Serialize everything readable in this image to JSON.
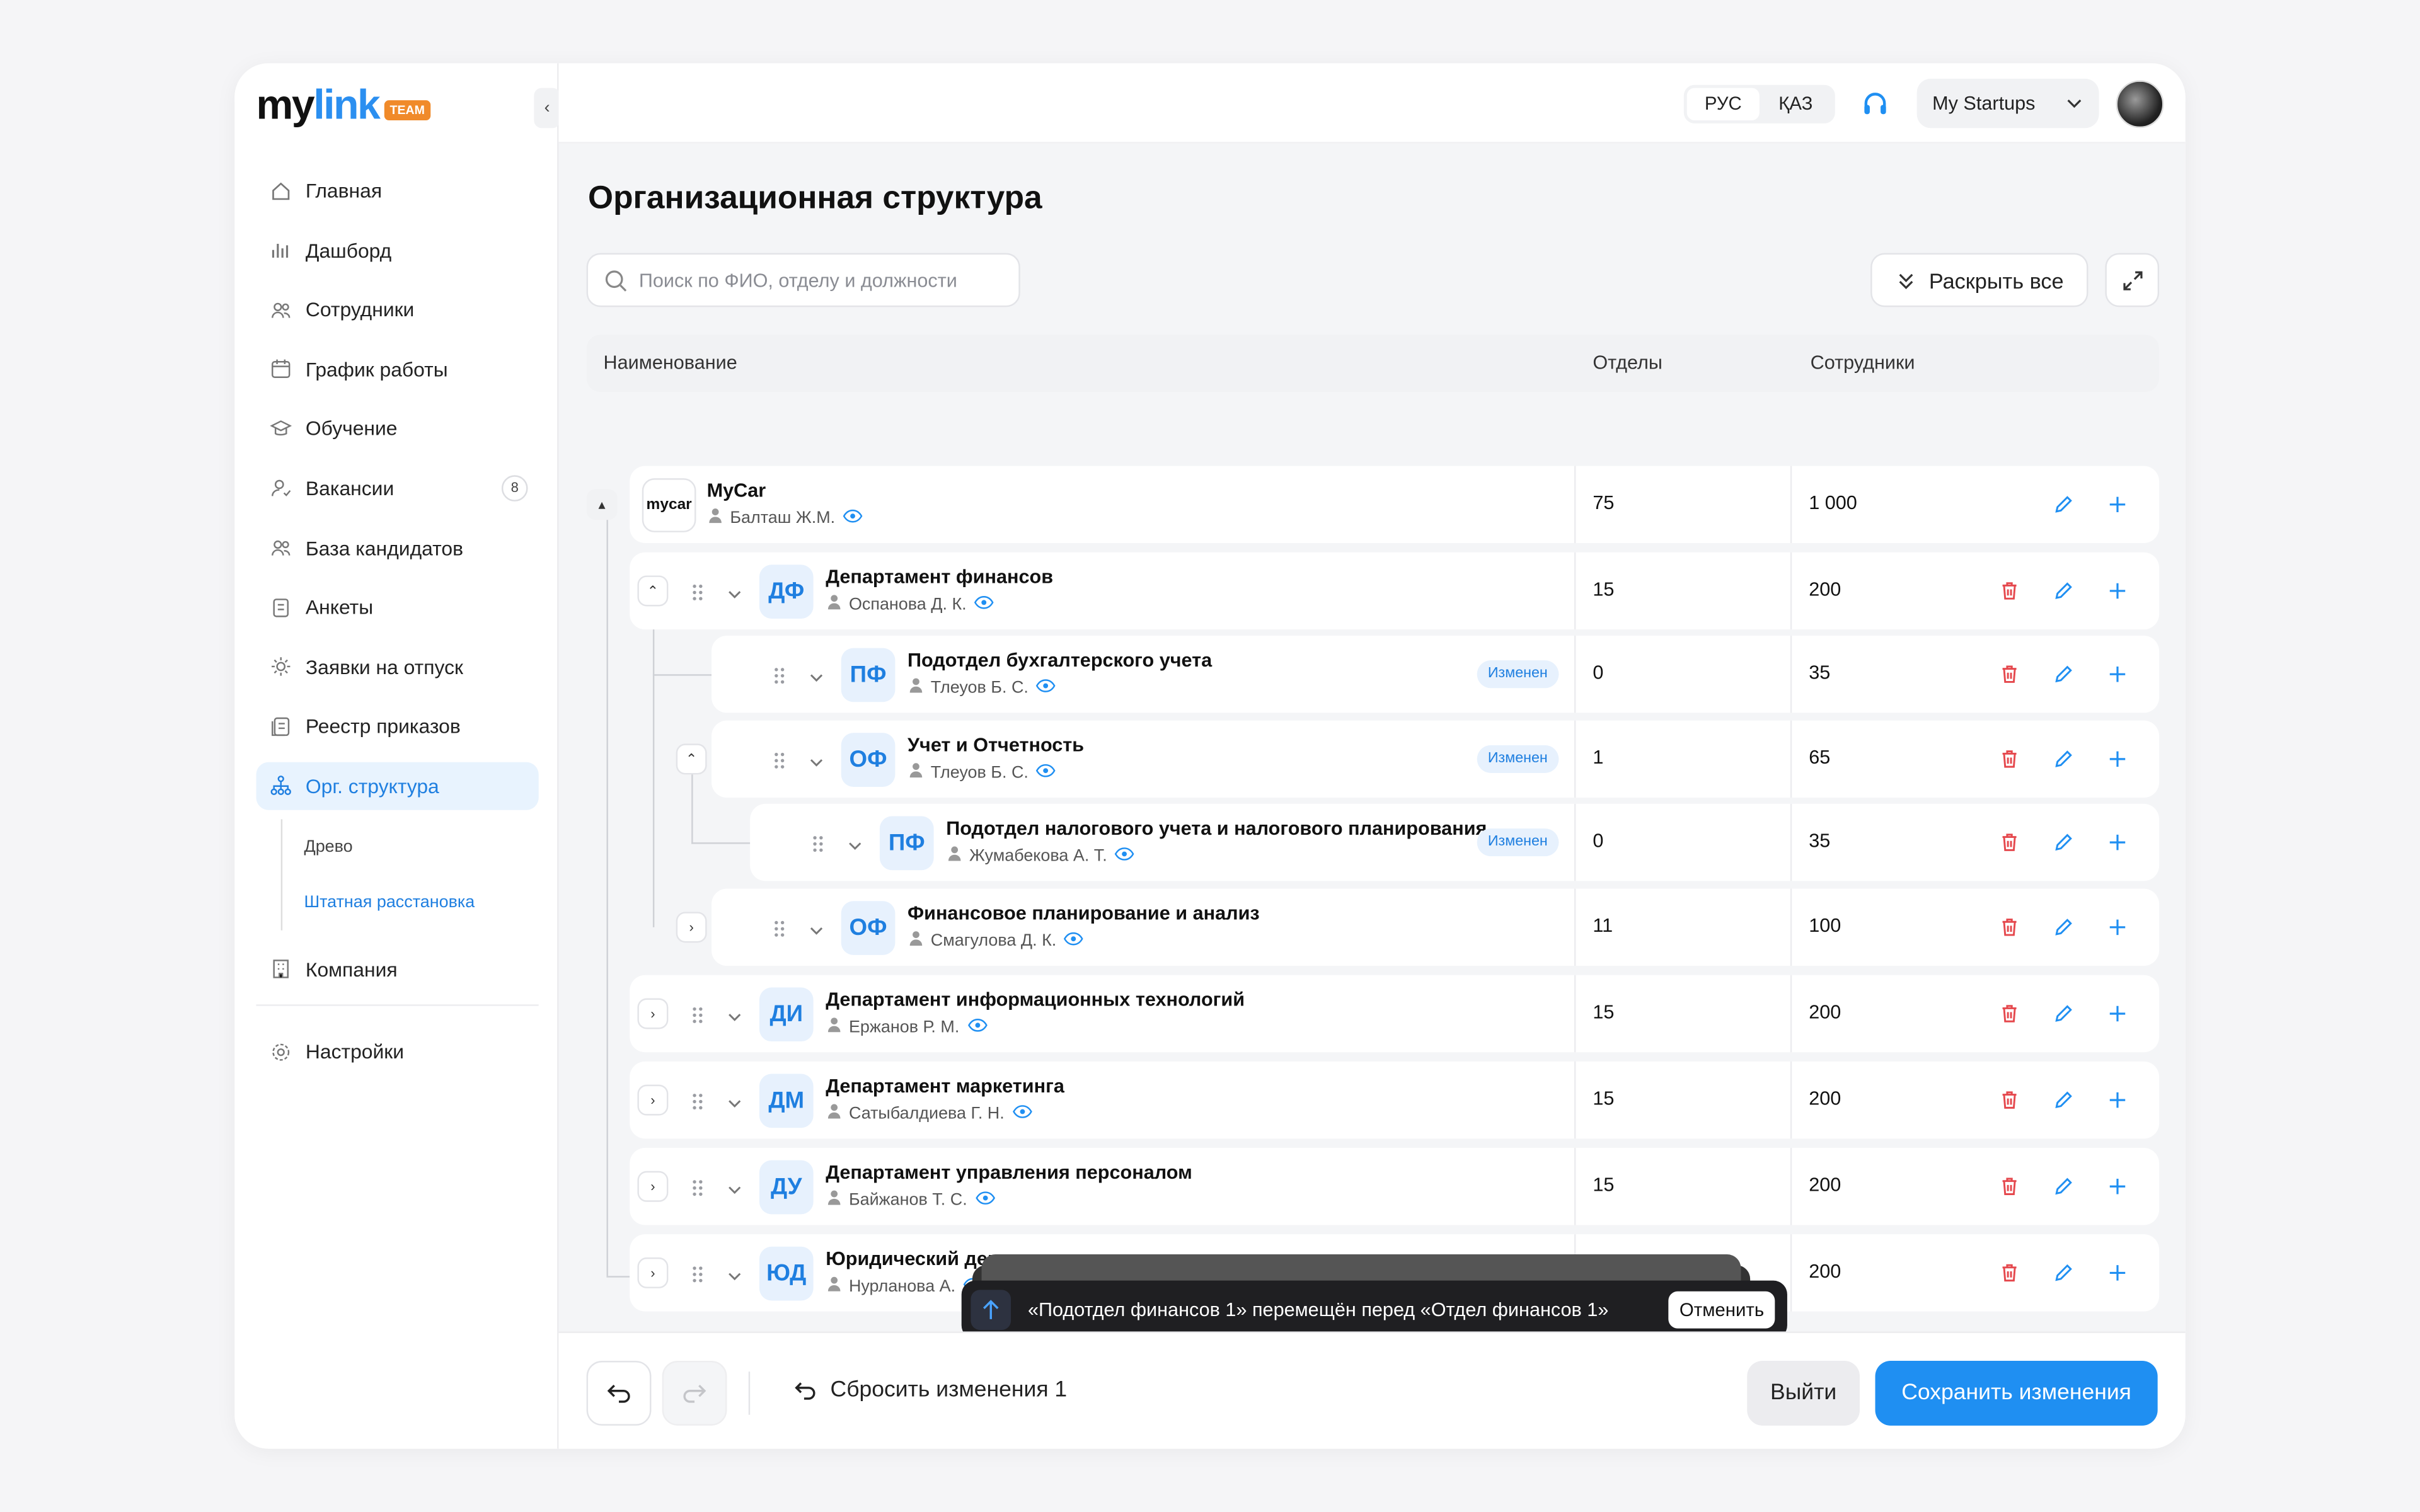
{
  "app": {
    "logo_my": "mylink",
    "logo_team": "TEAM"
  },
  "sidebar": {
    "items": [
      {
        "label": "Главная",
        "icon": "home-icon"
      },
      {
        "label": "Дашборд",
        "icon": "chart-icon"
      },
      {
        "label": "Сотрудники",
        "icon": "users-icon"
      },
      {
        "label": "График работы",
        "icon": "calendar-icon"
      },
      {
        "label": "Обучение",
        "icon": "education-icon"
      },
      {
        "label": "Вакансии",
        "icon": "vacancy-icon",
        "badge": "8"
      },
      {
        "label": "База кандидатов",
        "icon": "candidates-icon"
      },
      {
        "label": "Анкеты",
        "icon": "form-icon"
      },
      {
        "label": "Заявки на отпуск",
        "icon": "sun-icon"
      },
      {
        "label": "Реестр приказов",
        "icon": "orders-icon"
      },
      {
        "label": "Орг. структура",
        "icon": "org-icon",
        "active": true
      }
    ],
    "sub": [
      "Древо",
      "Штатная расстановка"
    ],
    "company": "Компания",
    "settings": "Настройки"
  },
  "topbar": {
    "lang": [
      "РУС",
      "ҚАЗ"
    ],
    "lang_active": "РУС",
    "workspace": "My Startups"
  },
  "page": {
    "title": "Организационная структура",
    "search_placeholder": "Поиск по ФИО, отделу и должности",
    "expand_all": "Раскрыть все"
  },
  "table": {
    "headers": {
      "name": "Наименование",
      "depts": "Отделы",
      "employees": "Сотрудники"
    },
    "root": {
      "name": "MyCar",
      "logo": "mycar",
      "person": "Балташ Ж.М.",
      "depts": "75",
      "employees": "1 000"
    },
    "rows": [
      {
        "abbr": "ДФ",
        "name": "Департамент финансов",
        "person": "Оспанова Д. К.",
        "depts": "15",
        "employees": "200",
        "tag": ""
      },
      {
        "abbr": "ПФ",
        "name": "Подотдел бухгалтерского учета",
        "person": "Тлеуов Б. С.",
        "depts": "0",
        "employees": "35",
        "tag": "Изменен"
      },
      {
        "abbr": "ОФ",
        "name": "Учет и Отчетность",
        "person": "Тлеуов Б. С.",
        "depts": "1",
        "employees": "65",
        "tag": "Изменен"
      },
      {
        "abbr": "ПФ",
        "name": "Подотдел налогового учета и налогового планирования",
        "person": "Жумабекова А. Т.",
        "depts": "0",
        "employees": "35",
        "tag": "Изменен"
      },
      {
        "abbr": "ОФ",
        "name": "Финансовое планирование и анализ",
        "person": "Смагулова Д. К.",
        "depts": "11",
        "employees": "100",
        "tag": ""
      },
      {
        "abbr": "ДИ",
        "name": "Департамент информационных технологий",
        "person": "Ержанов Р. М.",
        "depts": "15",
        "employees": "200",
        "tag": ""
      },
      {
        "abbr": "ДМ",
        "name": "Департамент маркетинга",
        "person": "Сатыбалдиева Г. Н.",
        "depts": "15",
        "employees": "200",
        "tag": ""
      },
      {
        "abbr": "ДУ",
        "name": "Департамент управления персоналом",
        "person": "Байжанов Т. С.",
        "depts": "15",
        "employees": "200",
        "tag": ""
      },
      {
        "abbr": "ЮД",
        "name": "Юридический департамент",
        "person": "Нурланова А.",
        "depts": "",
        "employees": "200",
        "tag": ""
      }
    ]
  },
  "toast": {
    "message": "«Подотдел финансов 1» перемещён перед «Отдел финансов 1»",
    "undo": "Отменить"
  },
  "footer": {
    "reset": "Сбросить изменения 1",
    "exit": "Выйти",
    "save": "Сохранить изменения"
  },
  "colors": {
    "accent": "#1f8ff2",
    "danger": "#e5484d",
    "tag_bg": "#e7f1fd"
  }
}
